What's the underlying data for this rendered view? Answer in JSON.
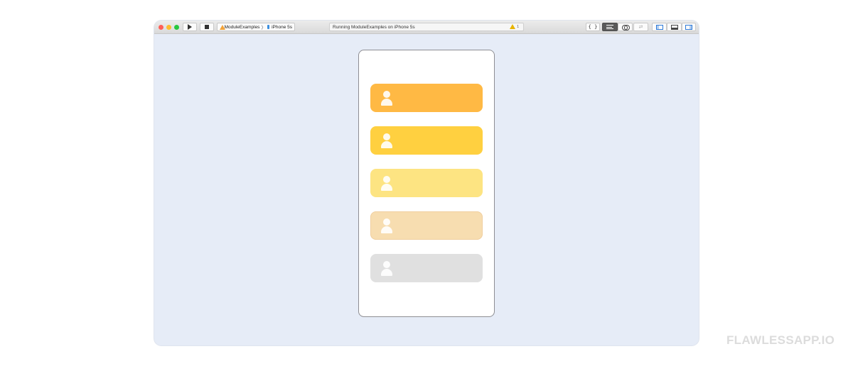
{
  "window": {
    "traffic_lights": {
      "close": "#ff5f57",
      "minimize": "#febc2e",
      "zoom": "#28c840"
    },
    "scheme": {
      "project": "ModuleExamples",
      "device": "iPhone 5s"
    },
    "status": {
      "text": "Running ModuleExamples on iPhone 5s",
      "warning_count": "1"
    }
  },
  "toolbar_icons": [
    "play-icon",
    "stop-icon",
    "hammer-icon",
    "device-icon",
    "warning-icon",
    "braces-icon",
    "editor-icon",
    "assistant-icon",
    "version-icon",
    "navigator-icon",
    "debug-area-icon",
    "inspector-icon"
  ],
  "phone": {
    "cards": [
      {
        "color": "#ffb944",
        "icon": "person-icon"
      },
      {
        "color": "#ffd040",
        "icon": "person-icon"
      },
      {
        "color": "#fde482",
        "icon": "person-icon"
      },
      {
        "color": "#f7ddb0",
        "icon": "person-icon"
      },
      {
        "color": "#e0e0e0",
        "icon": "person-icon"
      }
    ]
  },
  "watermark": "FLAWLESSAPP.IO"
}
